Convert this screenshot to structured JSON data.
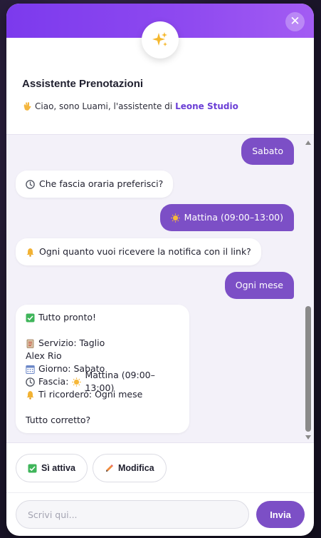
{
  "header": {
    "title": "Assistente Prenotazioni",
    "greeting": "Ciao, sono Luami, l'assistente di",
    "brand": "Leone Studio",
    "close_label": "✕"
  },
  "messages": [
    {
      "from": "user",
      "text": "Sabato"
    },
    {
      "from": "bot",
      "icon": "clock-icon",
      "text": "Che fascia oraria preferisci?"
    },
    {
      "from": "user",
      "icon": "sun-icon",
      "text": "Mattina (09:00–13:00)"
    },
    {
      "from": "bot",
      "icon": "bell-icon",
      "text": "Ogni quanto vuoi ricevere la notifica con il link?"
    },
    {
      "from": "user",
      "text": "Ogni mese"
    }
  ],
  "summary": {
    "line1": "Tutto pronto!",
    "service": "Servizio: Taglio",
    "staff": "Alex Rio",
    "day": "Giorno: Sabato",
    "slot_prefix": "Fascia:",
    "slot_value": "Mattina (09:00–13:00)",
    "reminder": "Ti ricorderò: Ogni mese",
    "question": "Tutto corretto?"
  },
  "actions": {
    "confirm_label": "Sì attiva",
    "edit_label": "Modifica"
  },
  "composer": {
    "placeholder": "Scrivi qui...",
    "send_label": "Invia"
  },
  "colors": {
    "accent": "#7c4fc6",
    "header_gradient_start": "#7c3aed",
    "header_gradient_end": "#a35cf3",
    "brand_text": "#6b3fd6"
  }
}
